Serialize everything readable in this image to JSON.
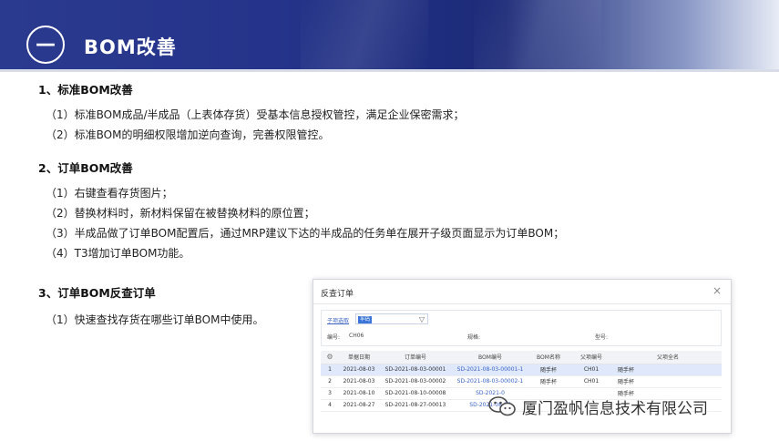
{
  "header": {
    "badge": "—",
    "title": "BOM改善"
  },
  "sections": [
    {
      "heading": "1、标准BOM改善",
      "items": [
        "（1）标准BOM成品/半成品（上表体存货）受基本信息授权管控，满足企业保密需求；",
        "（2）标准BOM的明细权限增加逆向查询，完善权限管控。"
      ]
    },
    {
      "heading": "2、订单BOM改善",
      "items": [
        "（1）右键查看存货图片；",
        "（2）替换材料时，新材料保留在被替换材料的原位置；",
        "（3）半成品做了订单BOM配置后，通过MRP建议下达的半成品的任务单在展开子级页面显示为订单BOM；",
        "（4）T3增加订单BOM功能。"
      ]
    },
    {
      "heading": "3、订单BOM反查订单",
      "items": [
        "（1）快速查找存货在哪些订单BOM中使用。"
      ]
    }
  ],
  "dialog": {
    "title": "反查订单",
    "close": "×",
    "filter": {
      "link_label": "子项选取",
      "input_value": "半码",
      "code_label": "编号:",
      "code_value": "CH06",
      "spec_label": "规格:",
      "model_label": "型号:"
    },
    "columns": [
      "",
      "单据日期",
      "订单编号",
      "BOM编号",
      "BOM名称",
      "父项编号",
      "父项全名"
    ],
    "rows": [
      [
        "1",
        "2021-08-03",
        "SD-2021-08-03-00001",
        "SD-2021-08-03-00001-1",
        "随手杯",
        "CH01",
        "随手杯"
      ],
      [
        "2",
        "2021-08-03",
        "SD-2021-08-03-00002",
        "SD-2021-08-03-00002-1",
        "随手杯",
        "CH01",
        "随手杯"
      ],
      [
        "3",
        "2021-08-10",
        "SD-2021-08-10-00008",
        "SD-2021-0",
        "",
        "",
        "随手杯"
      ],
      [
        "4",
        "2021-08-27",
        "SD-2021-08-27-00013",
        "SD-2021-08-27",
        "",
        "",
        ""
      ]
    ]
  },
  "watermark": {
    "text": "厦门盈帆信息技术有限公司"
  },
  "colors": {
    "header_dark": "#25348a",
    "link": "#3b62c6",
    "selected_row": "#dfe9fb"
  }
}
